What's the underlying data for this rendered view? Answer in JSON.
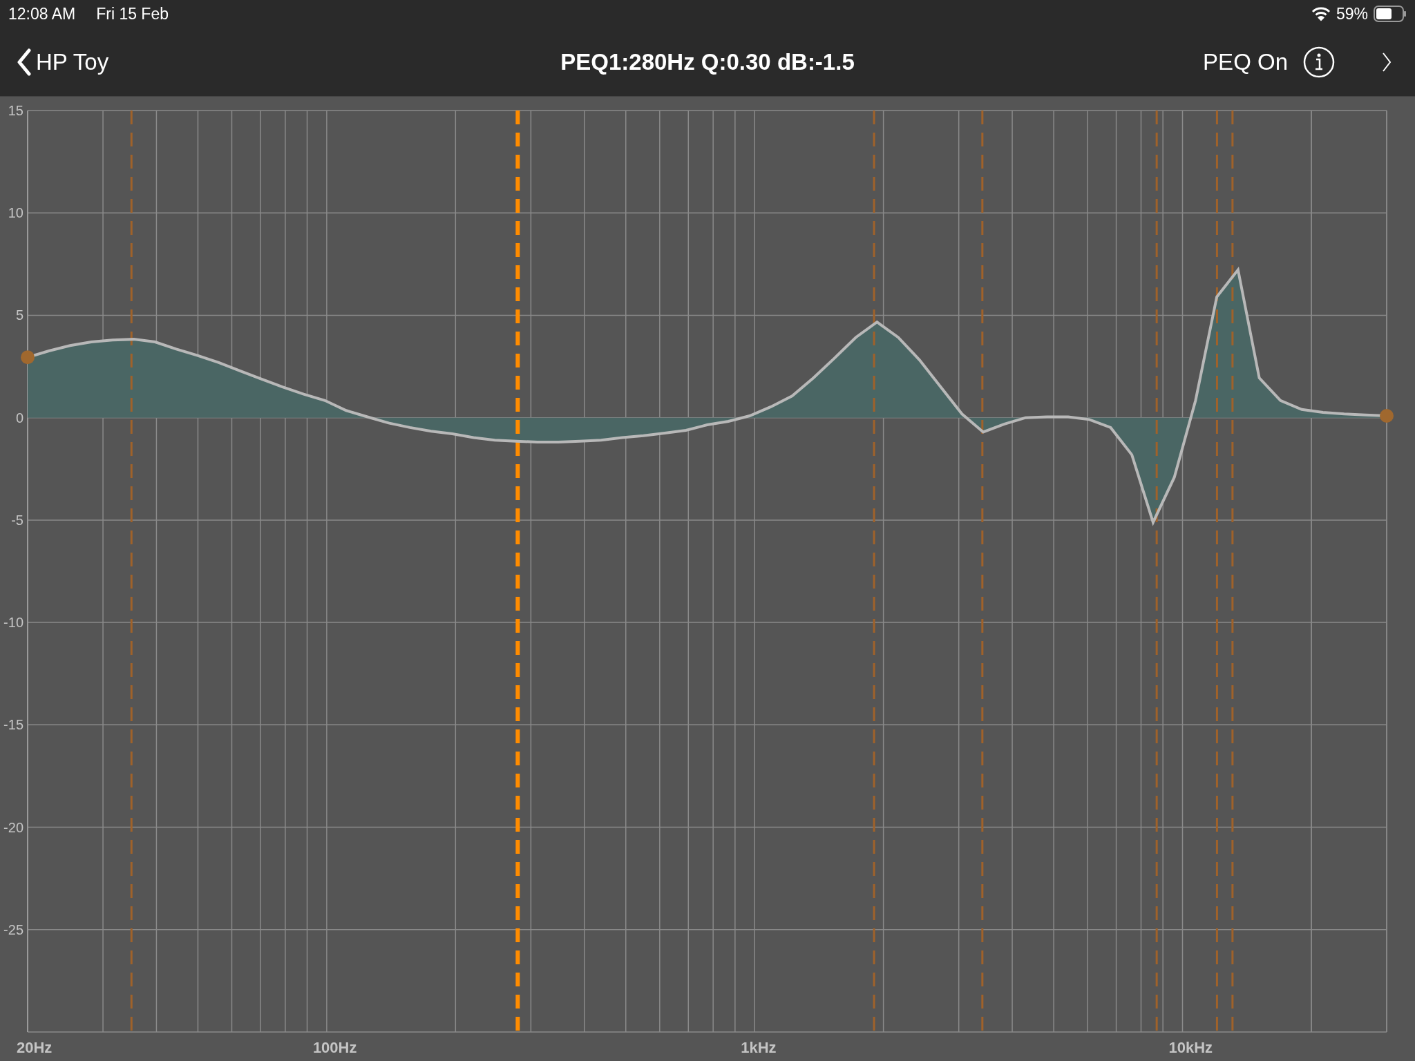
{
  "status_bar": {
    "time": "12:08 AM",
    "date": "Fri 15 Feb",
    "battery": "59%"
  },
  "nav_bar": {
    "back_label": "HP Toy",
    "title": "PEQ1:280Hz Q:0.30 dB:-1.5",
    "peq_toggle": "PEQ On"
  },
  "chart_data": {
    "type": "line",
    "categories": [
      null,
      null,
      null,
      null,
      null,
      null,
      null,
      null,
      null,
      null,
      null,
      null,
      null,
      null,
      null,
      null,
      null,
      null,
      null,
      null,
      null,
      null,
      null,
      null,
      null,
      null,
      null,
      null,
      null,
      null,
      null,
      null,
      null,
      null,
      null,
      null,
      null,
      null,
      null,
      null,
      null,
      null,
      null,
      null,
      null,
      null,
      null,
      null,
      null,
      null,
      null,
      null,
      null,
      null,
      null,
      null,
      null,
      null,
      null,
      null,
      null,
      null,
      null,
      null,
      null
    ],
    "series": [
      {
        "color": "#b8b8b8",
        "values": [
          2.95,
          3.26,
          3.52,
          3.7,
          3.79,
          3.83,
          3.7,
          3.35,
          3.04,
          2.69,
          2.29,
          1.89,
          1.5,
          1.15,
          0.84,
          0.35,
          0.04,
          -0.26,
          -0.48,
          -0.66,
          -0.79,
          -0.97,
          -1.1,
          -1.15,
          -1.19,
          -1.19,
          -1.15,
          -1.1,
          -0.97,
          -0.88,
          -0.75,
          -0.62,
          -0.35,
          -0.18,
          0.09,
          0.53,
          1.06,
          1.94,
          2.91,
          3.92,
          4.67,
          3.92,
          2.82,
          1.5,
          0.18,
          -0.7,
          -0.31,
          0,
          0.04,
          0.04,
          -0.09,
          -0.48,
          -1.81,
          -5.11,
          -2.91,
          0.84,
          5.9,
          7.22,
          1.94,
          0.84,
          0.4,
          0.26,
          0.18,
          0.13,
          0.09
        ]
      }
    ],
    "ylim": [
      -30,
      15
    ],
    "yticks": [
      15,
      10,
      5,
      0,
      -5,
      -10,
      -15,
      -20,
      -25
    ],
    "grid": true
  },
  "frequency_axis": [
    "20Hz",
    "100Hz",
    "1kHz",
    "10kHz"
  ]
}
